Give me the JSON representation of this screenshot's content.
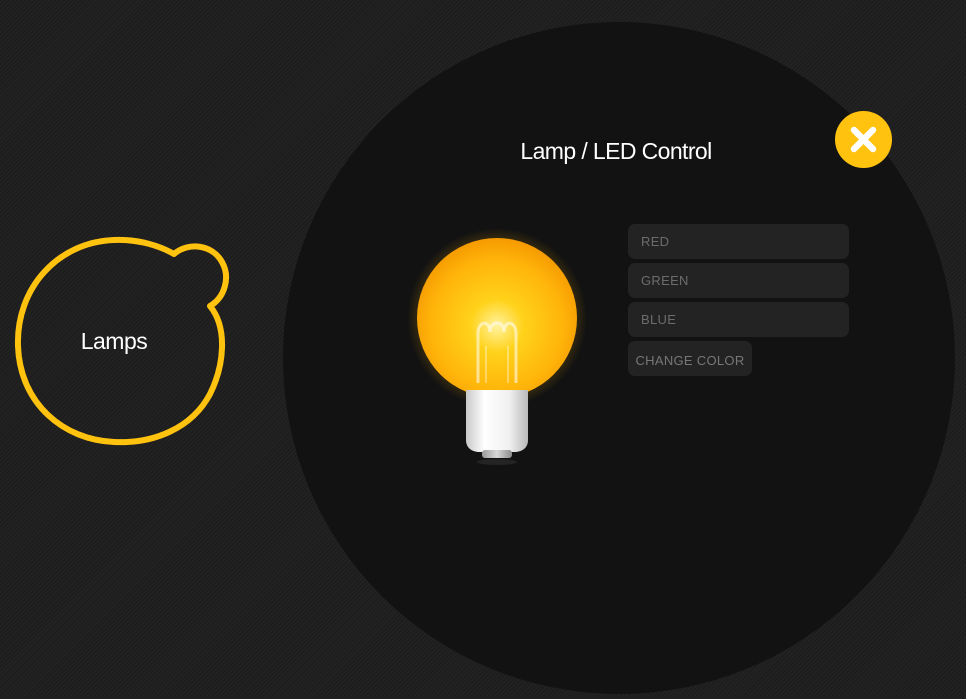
{
  "nav": {
    "lamps_label": "Lamps"
  },
  "modal": {
    "title": "Lamp / LED Control"
  },
  "color_form": {
    "red_placeholder": "RED",
    "green_placeholder": "GREEN",
    "blue_placeholder": "BLUE",
    "change_color_label": "CHANGE COLOR"
  },
  "colors": {
    "accent": "#ffc20e",
    "background": "#222222",
    "modal_background": "#121212",
    "field_background": "#232323"
  },
  "icons": {
    "close": "close-icon",
    "bulb": "light-bulb-icon"
  }
}
